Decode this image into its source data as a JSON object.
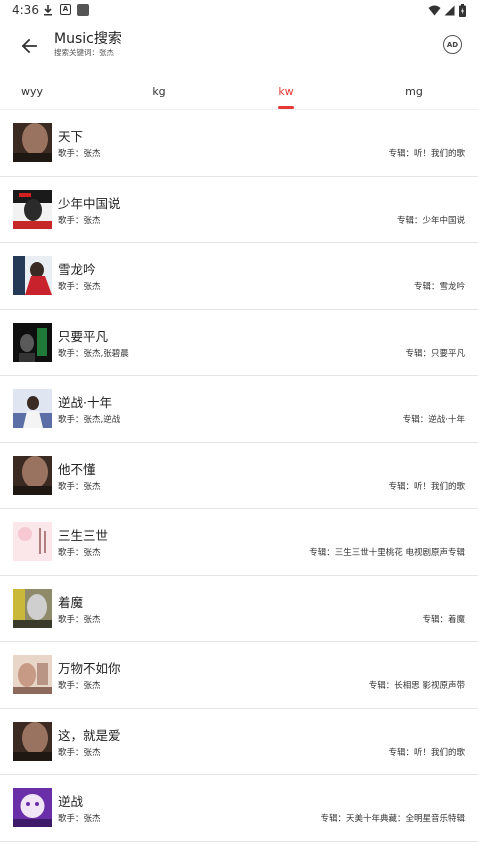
{
  "status_bar": {
    "time": "4:36",
    "icons": [
      "download-icon",
      "a-icon",
      "app-square-icon",
      "wifi-icon",
      "signal-icon",
      "battery-icon"
    ]
  },
  "app_bar": {
    "title": "Music搜索",
    "subtitle": "搜索关键词：张杰",
    "ad_label": "AD"
  },
  "tabs": [
    {
      "label": "wyy",
      "active": false
    },
    {
      "label": "kg",
      "active": false
    },
    {
      "label": "kw",
      "active": true
    },
    {
      "label": "mg",
      "active": false
    }
  ],
  "colors": {
    "accent": "#e53935",
    "divider": "#e4e4e4",
    "text": "#222222"
  },
  "songs": [
    {
      "title": "天下",
      "artist": "歌手：张杰",
      "album": "专辑：听！我们的歌"
    },
    {
      "title": "少年中国说",
      "artist": "歌手：张杰",
      "album": "专辑：少年中国说"
    },
    {
      "title": "雪龙吟",
      "artist": "歌手：张杰",
      "album": "专辑：雪龙吟"
    },
    {
      "title": "只要平凡",
      "artist": "歌手：张杰,张碧晨",
      "album": "专辑：只要平凡"
    },
    {
      "title": "逆战·十年",
      "artist": "歌手：张杰,逆战",
      "album": "专辑：逆战·十年"
    },
    {
      "title": "他不懂",
      "artist": "歌手：张杰",
      "album": "专辑：听！我们的歌"
    },
    {
      "title": "三生三世",
      "artist": "歌手：张杰",
      "album": "专辑：三生三世十里桃花 电视剧原声专辑"
    },
    {
      "title": "着魔",
      "artist": "歌手：张杰",
      "album": "专辑：着魔"
    },
    {
      "title": "万物不如你",
      "artist": "歌手：张杰",
      "album": "专辑：长相思 影视原声带"
    },
    {
      "title": "这，就是爱",
      "artist": "歌手：张杰",
      "album": "专辑：听！我们的歌"
    },
    {
      "title": "逆战",
      "artist": "歌手：张杰",
      "album": "专辑：天美十年典藏：全明星音乐特辑"
    }
  ]
}
